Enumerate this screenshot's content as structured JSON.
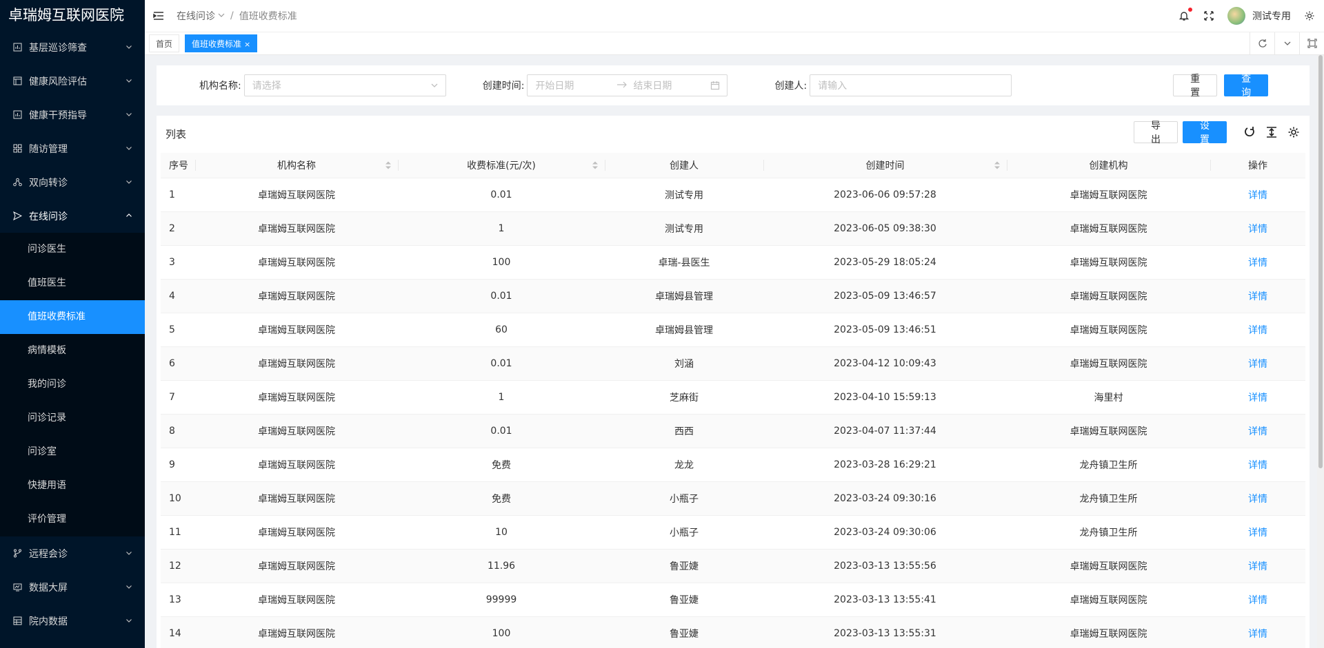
{
  "app": {
    "title": "卓瑞姆互联网医院"
  },
  "sidebar": {
    "items": [
      {
        "label": "基层巡诊筛查",
        "icon": "chart-icon"
      },
      {
        "label": "健康风险评估",
        "icon": "layout-icon"
      },
      {
        "label": "健康干预指导",
        "icon": "chart-icon"
      },
      {
        "label": "随访管理",
        "icon": "grid-icon"
      },
      {
        "label": "双向转诊",
        "icon": "share-icon"
      },
      {
        "label": "在线问诊",
        "icon": "send-icon",
        "open": true
      },
      {
        "label": "远程会诊",
        "icon": "branch-icon"
      },
      {
        "label": "数据大屏",
        "icon": "screen-icon"
      },
      {
        "label": "院内数据",
        "icon": "database-icon"
      }
    ],
    "submenu": [
      "问诊医生",
      "值班医生",
      "值班收费标准",
      "病情模板",
      "我的问诊",
      "问诊记录",
      "问诊室",
      "快捷用语",
      "评价管理"
    ],
    "active_sub": "值班收费标准"
  },
  "header": {
    "breadcrumb": [
      "在线问诊",
      "值班收费标准"
    ],
    "username": "测试专用"
  },
  "tabs": [
    {
      "label": "首页",
      "active": false
    },
    {
      "label": "值班收费标准",
      "active": true,
      "close": "×"
    }
  ],
  "filter": {
    "org_label": "机构名称:",
    "org_placeholder": "请选择",
    "time_label": "创建时间:",
    "start_placeholder": "开始日期",
    "end_placeholder": "结束日期",
    "creator_label": "创建人:",
    "creator_placeholder": "请输入",
    "reset": "重 置",
    "query": "查 询"
  },
  "table": {
    "title": "列表",
    "export": "导 出",
    "settings": "设 置",
    "columns": [
      "序号",
      "机构名称",
      "收费标准(元/次)",
      "创建人",
      "创建时间",
      "创建机构",
      "操作"
    ],
    "rows": [
      [
        "1",
        "卓瑞姆互联网医院",
        "0.01",
        "测试专用",
        "2023-06-06 09:57:28",
        "卓瑞姆互联网医院",
        "详情"
      ],
      [
        "2",
        "卓瑞姆互联网医院",
        "1",
        "测试专用",
        "2023-06-05 09:38:30",
        "卓瑞姆互联网医院",
        "详情"
      ],
      [
        "3",
        "卓瑞姆互联网医院",
        "100",
        "卓瑞-县医生",
        "2023-05-29 18:05:24",
        "卓瑞姆互联网医院",
        "详情"
      ],
      [
        "4",
        "卓瑞姆互联网医院",
        "0.01",
        "卓瑞姆县管理",
        "2023-05-09 13:46:57",
        "卓瑞姆互联网医院",
        "详情"
      ],
      [
        "5",
        "卓瑞姆互联网医院",
        "60",
        "卓瑞姆县管理",
        "2023-05-09 13:46:51",
        "卓瑞姆互联网医院",
        "详情"
      ],
      [
        "6",
        "卓瑞姆互联网医院",
        "0.01",
        "刘涵",
        "2023-04-12 10:09:43",
        "卓瑞姆互联网医院",
        "详情"
      ],
      [
        "7",
        "卓瑞姆互联网医院",
        "1",
        "芝麻街",
        "2023-04-10 15:59:13",
        "海里村",
        "详情"
      ],
      [
        "8",
        "卓瑞姆互联网医院",
        "0.01",
        "西西",
        "2023-04-07 11:37:44",
        "卓瑞姆互联网医院",
        "详情"
      ],
      [
        "9",
        "卓瑞姆互联网医院",
        "免费",
        "龙龙",
        "2023-03-28 16:29:21",
        "龙舟镇卫生所",
        "详情"
      ],
      [
        "10",
        "卓瑞姆互联网医院",
        "免费",
        "小瓶子",
        "2023-03-24 09:30:16",
        "龙舟镇卫生所",
        "详情"
      ],
      [
        "11",
        "卓瑞姆互联网医院",
        "10",
        "小瓶子",
        "2023-03-24 09:30:06",
        "龙舟镇卫生所",
        "详情"
      ],
      [
        "12",
        "卓瑞姆互联网医院",
        "11.96",
        "鲁亚婕",
        "2023-03-13 13:55:56",
        "卓瑞姆互联网医院",
        "详情"
      ],
      [
        "13",
        "卓瑞姆互联网医院",
        "99999",
        "鲁亚婕",
        "2023-03-13 13:55:41",
        "卓瑞姆互联网医院",
        "详情"
      ],
      [
        "14",
        "卓瑞姆互联网医院",
        "100",
        "鲁亚婕",
        "2023-03-13 13:55:31",
        "卓瑞姆互联网医院",
        "详情"
      ]
    ]
  },
  "colors": {
    "primary": "#1890ff",
    "sidebar": "#001529",
    "submenu": "#000c17"
  }
}
